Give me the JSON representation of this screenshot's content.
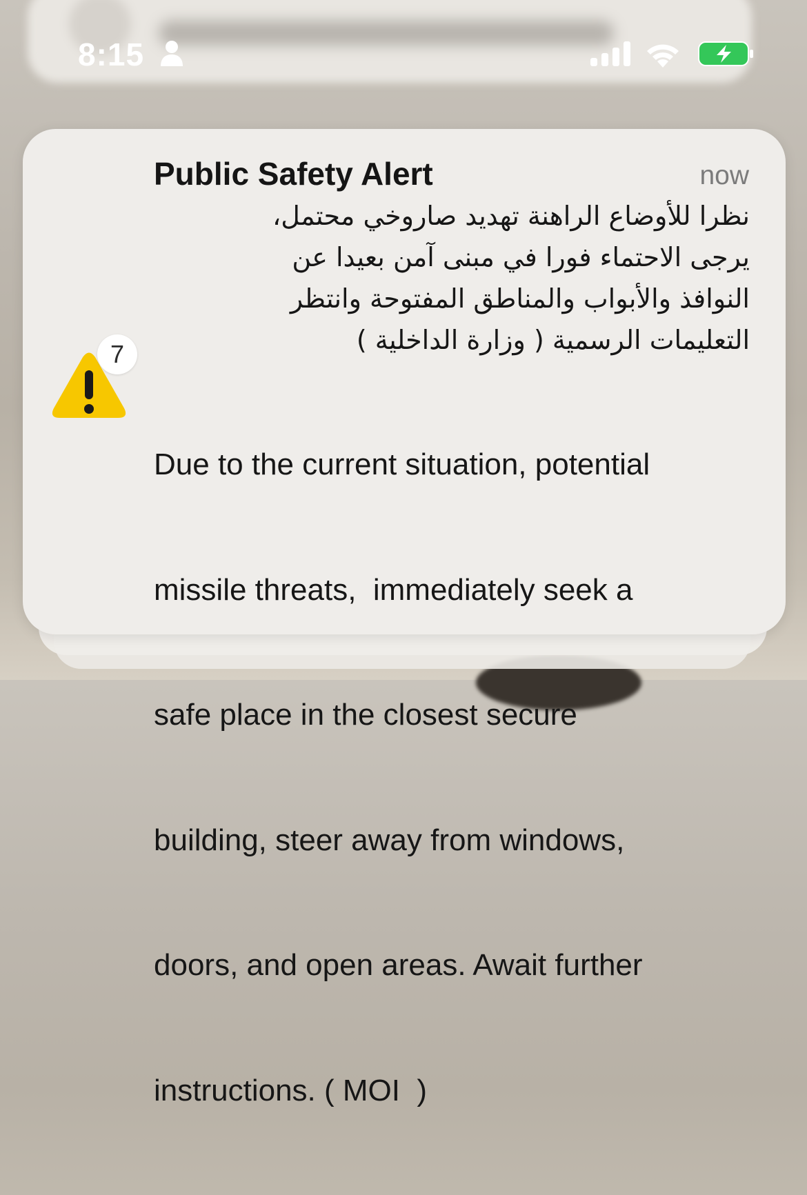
{
  "status_bar": {
    "time": "8:15",
    "person_icon": "person-icon",
    "signal_icon": "cellular-signal-icon",
    "wifi_icon": "wifi-icon",
    "battery_icon": "battery-charging-icon",
    "battery_color": "#34c759"
  },
  "notification": {
    "title": "Public Safety Alert",
    "timestamp": "now",
    "icon": "warning-triangle-icon",
    "icon_color": "#f7c700",
    "count": "7",
    "arabic_lines": [
      "نظرا للأوضاع الراهنة تهديد صاروخي محتمل،",
      "يرجى الاحتماء فورا في مبنى آمن بعيدا عن",
      "النوافذ والأبواب والمناطق المفتوحة وانتظر",
      "التعليمات الرسمية ( وزارة الداخلية )"
    ],
    "english_lines": [
      "Due to the current situation, potential",
      "missile threats,  immediately seek a",
      "safe place in the closest secure",
      "building, steer away from windows,",
      "doors, and open areas. Await further",
      "instructions. ( MOI  )"
    ]
  }
}
